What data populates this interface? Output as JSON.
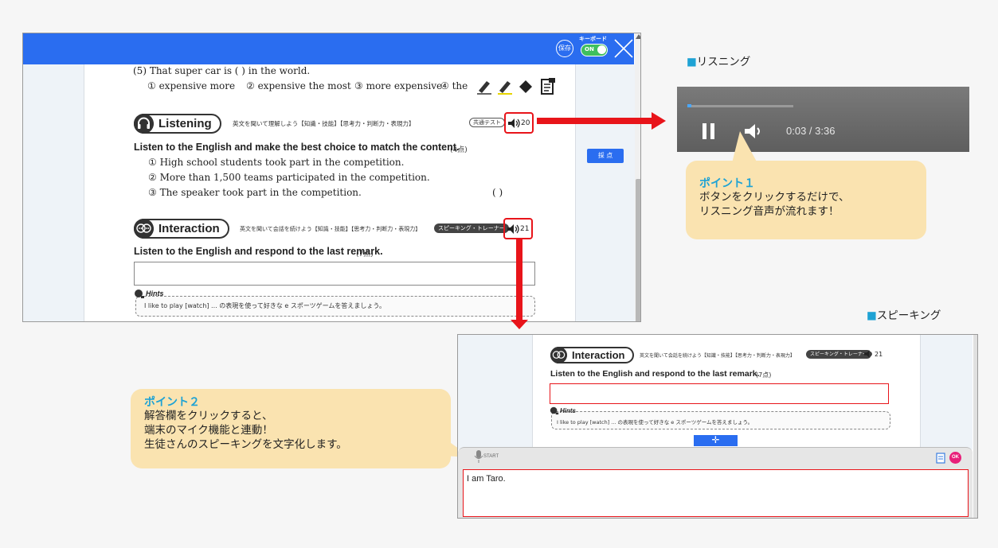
{
  "main_window": {
    "save_label": "保存",
    "keyboard_label": "キーボード",
    "toggle_label": "ON",
    "question5": {
      "stem": "(5)  That super car is (          ) in the world.",
      "choice1": "① expensive more",
      "choice2": "② expensive the most",
      "choice3": "③ more expensive",
      "choice4": "④ the"
    },
    "listening": {
      "title": "Listening",
      "subtitle": "英文を聞いて理解しよう【知識・技能】【思考力・判断力・表現力】",
      "badge": "共通テスト",
      "track": "20",
      "question": "Listen to the English and make the best choice to match the content.",
      "points": "(4点)",
      "choices": [
        "① High school students took part in the competition.",
        "② More than 1,500 teams participated in the competition.",
        "③ The speaker took part in the competition."
      ],
      "answer_paren": "(          )"
    },
    "interaction": {
      "title": "Interaction",
      "subtitle": "英文を聞いて会話を続けよう【知識・技能】【思考力・判断力・表現力】",
      "badge": "スピーキング・トレーナー",
      "track": "21",
      "question": "Listen to the English and respond to the last remark.",
      "points": "(7点)",
      "hints_label": "Hints",
      "hint_text": "I like to play [watch] ... の表現を使って好きな e スポーツゲームを答えましょう。"
    },
    "score_button": "採 点"
  },
  "listening_section": {
    "label_square": "■",
    "label": "リスニング",
    "player_time": "0:03 / 3:36",
    "progress": 0.0138
  },
  "callout1": {
    "title": "ポイント１",
    "line1": "ボタンをクリックするだけで、",
    "line2": "リスニング音声が流れます！"
  },
  "speaking_section": {
    "label_square": "■",
    "label": "スピーキング"
  },
  "callout2": {
    "title": "ポイント２",
    "line1": "解答欄をクリックすると、",
    "line2": "端末のマイク機能と連動！",
    "line3": "生徒さんのスピーキングを文字化します。"
  },
  "speak_window": {
    "title": "Interaction",
    "subtitle": "英文を聞いて会話を続けよう【知識・技能】【思考力・判断力・表現力】",
    "badge": "スピーキング・トレーナー",
    "track": "21",
    "question": "Listen to the English and respond to the last remark.",
    "points": "(7点)",
    "hints_label": "Hints",
    "hint_text": "I like to play [watch] ... の表現を使って好きな e スポーツゲームを答えましょう。",
    "move_icon": "✛",
    "mic_label": "START",
    "ok_label": "OK",
    "transcript": "I am Taro."
  },
  "colors": {
    "topbar": "#2a6df0",
    "accent_red": "#e8141a",
    "callout_bg": "#fae3b0",
    "callout_title": "#1ea2d4"
  }
}
